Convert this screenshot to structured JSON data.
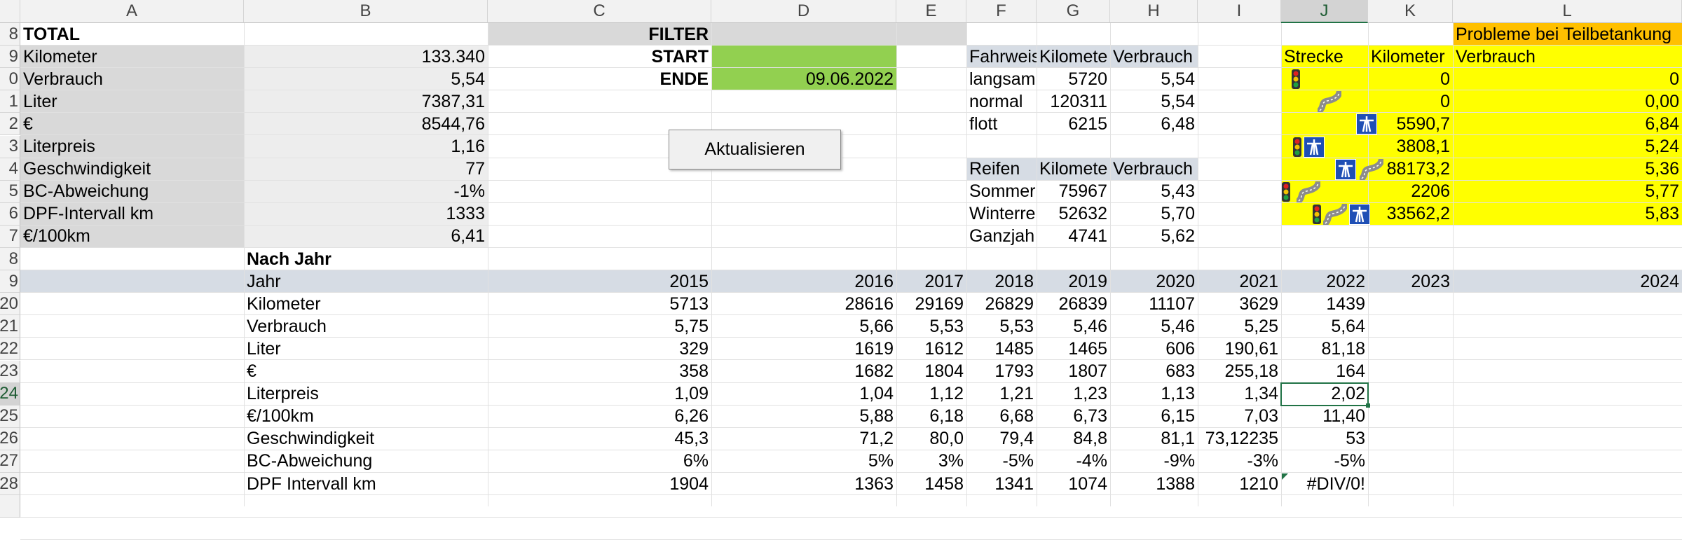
{
  "columns": [
    "A",
    "B",
    "C",
    "D",
    "E",
    "F",
    "G",
    "H",
    "I",
    "J",
    "K",
    "L"
  ],
  "selected_column": "J",
  "rows": [
    "8",
    "9",
    "0",
    "1",
    "2",
    "3",
    "4",
    "5",
    "6",
    "7",
    "8",
    "9",
    "20",
    "21",
    "22",
    "23",
    "24",
    "25",
    "26",
    "27",
    "28",
    ""
  ],
  "selected_row": "24",
  "total": {
    "title": "TOTAL",
    "items": [
      {
        "label": "Kilometer",
        "value": "133.340"
      },
      {
        "label": "Verbrauch",
        "value": "5,54"
      },
      {
        "label": "Liter",
        "value": "7387,31"
      },
      {
        "label": "€",
        "value": "8544,76"
      },
      {
        "label": "Literpreis",
        "value": "1,16"
      },
      {
        "label": "Geschwindigkeit",
        "value": "77"
      },
      {
        "label": "BC-Abweichung",
        "value": "-1%"
      },
      {
        "label": "DPF-Intervall km",
        "value": "1333"
      },
      {
        "label": "€/100km",
        "value": "6,41"
      }
    ]
  },
  "filter": {
    "title": "FILTER",
    "start_label": "START",
    "start_value": "",
    "end_label": "ENDE",
    "end_value": "09.06.2022",
    "button_label": "Aktualisieren"
  },
  "fahrweise": {
    "headers": [
      "Fahrweis",
      "Kilomete",
      "Verbrauch"
    ],
    "rows": [
      [
        "langsam",
        "5720",
        "5,54"
      ],
      [
        "normal",
        "120311",
        "5,54"
      ],
      [
        "flott",
        "6215",
        "6,48"
      ]
    ]
  },
  "reifen": {
    "headers": [
      "Reifen",
      "Kilomete",
      "Verbrauch"
    ],
    "rows": [
      [
        "Sommer",
        "75967",
        "5,43"
      ],
      [
        "Winterre",
        "52632",
        "5,70"
      ],
      [
        "Ganzjah",
        "4741",
        "5,62"
      ]
    ]
  },
  "strecke": {
    "banner": "Probleme bei Teilbetankung",
    "headers": [
      "Strecke",
      "Kilometer",
      "Verbrauch"
    ],
    "rows": [
      {
        "icons": [
          "traffic-light-icon"
        ],
        "km": "0",
        "v": "0"
      },
      {
        "icons": [
          "curvy-road-icon"
        ],
        "km": "0",
        "v": "0,00"
      },
      {
        "icons": [
          "highway-icon"
        ],
        "km": "5590,7",
        "v": "6,84"
      },
      {
        "icons": [
          "traffic-light-icon",
          "highway-icon"
        ],
        "km": "3808,1",
        "v": "5,24"
      },
      {
        "icons": [
          "highway-icon",
          "curvy-road-icon"
        ],
        "km": "88173,2",
        "v": "5,36"
      },
      {
        "icons": [
          "traffic-light-icon",
          "curvy-road-icon"
        ],
        "km": "2206",
        "v": "5,77"
      },
      {
        "icons": [
          "traffic-light-icon",
          "curvy-road-icon",
          "highway-icon"
        ],
        "km": "33562,2",
        "v": "5,83"
      }
    ]
  },
  "nach_jahr": {
    "title": "Nach Jahr",
    "header_label": "Jahr",
    "years": [
      "2015",
      "2016",
      "2017",
      "2018",
      "2019",
      "2020",
      "2021",
      "2022",
      "2023",
      "2024"
    ],
    "rows": [
      {
        "label": "Kilometer",
        "values": [
          "5713",
          "28616",
          "29169",
          "26829",
          "26839",
          "11107",
          "3629",
          "1439",
          "",
          ""
        ]
      },
      {
        "label": "Verbrauch",
        "values": [
          "5,75",
          "5,66",
          "5,53",
          "5,53",
          "5,46",
          "5,46",
          "5,25",
          "5,64",
          "",
          ""
        ]
      },
      {
        "label": "Liter",
        "values": [
          "329",
          "1619",
          "1612",
          "1485",
          "1465",
          "606",
          "190,61",
          "81,18",
          "",
          ""
        ]
      },
      {
        "label": "€",
        "values": [
          "358",
          "1682",
          "1804",
          "1793",
          "1807",
          "683",
          "255,18",
          "164",
          "",
          ""
        ]
      },
      {
        "label": "Literpreis",
        "values": [
          "1,09",
          "1,04",
          "1,12",
          "1,21",
          "1,23",
          "1,13",
          "1,34",
          "2,02",
          "",
          ""
        ]
      },
      {
        "label": "€/100km",
        "values": [
          "6,26",
          "5,88",
          "6,18",
          "6,68",
          "6,73",
          "6,15",
          "7,03",
          "11,40",
          "",
          ""
        ]
      },
      {
        "label": "Geschwindigkeit",
        "values": [
          "45,3",
          "71,2",
          "80,0",
          "79,4",
          "84,8",
          "81,1",
          "73,12235",
          "53",
          "",
          ""
        ]
      },
      {
        "label": "BC-Abweichung",
        "values": [
          "6%",
          "5%",
          "3%",
          "-5%",
          "-4%",
          "-9%",
          "-3%",
          "-5%",
          "",
          ""
        ]
      },
      {
        "label": "DPF Intervall km",
        "values": [
          "1904",
          "1363",
          "1458",
          "1341",
          "1074",
          "1388",
          "1210",
          "#DIV/0!",
          "",
          ""
        ]
      }
    ]
  },
  "colors": {
    "gray_fill": "#d9d9d9",
    "light_gray_fill": "#ededed",
    "green_fill": "#92d050",
    "yellow_fill": "#ffff00",
    "orange_fill": "#ffc000",
    "header_blue": "#d6dce4",
    "selection_green": "#217346"
  }
}
